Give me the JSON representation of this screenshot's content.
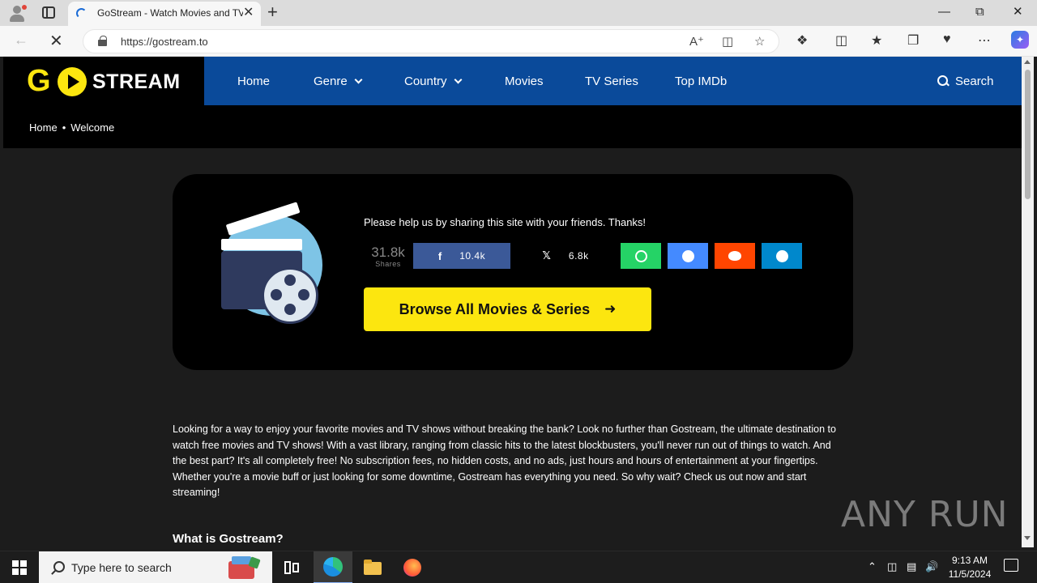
{
  "browser": {
    "tab_title": "GoStream - Watch Movies and TV",
    "url": "https://gostream.to",
    "new_tab_glyph": "+",
    "close_glyph": "✕"
  },
  "site": {
    "logo": {
      "letters": "G",
      "word": "STREAM"
    },
    "nav": [
      {
        "label": "Home"
      },
      {
        "label": "Genre",
        "dropdown": true
      },
      {
        "label": "Country",
        "dropdown": true
      },
      {
        "label": "Movies"
      },
      {
        "label": "TV Series"
      },
      {
        "label": "Top IMDb"
      }
    ],
    "search_label": "Search",
    "breadcrumb": [
      "Home",
      "Welcome"
    ],
    "share": {
      "message": "Please help us by sharing this site with your friends. Thanks!",
      "total_count": "31.8k",
      "total_label": "Shares",
      "buttons": [
        {
          "network": "facebook",
          "icon": "f",
          "count": "10.4k",
          "color": "#3b5998"
        },
        {
          "network": "x",
          "icon": "𝕏",
          "count": "6.8k",
          "color": "#000000"
        },
        {
          "network": "whatsapp",
          "color": "#25d366"
        },
        {
          "network": "messenger",
          "color": "#448aff"
        },
        {
          "network": "reddit",
          "color": "#ff4500"
        },
        {
          "network": "telegram",
          "color": "#0088cc"
        }
      ]
    },
    "browse_button": "Browse All Movies & Series",
    "intro": "Looking for a way to enjoy your favorite movies and TV shows without breaking the bank? Look no further than Gostream, the ultimate destination to watch free movies and TV shows! With a vast library, ranging from classic hits to the latest blockbusters, you'll never run out of things to watch. And the best part? It's all completely free! No subscription fees, no hidden costs, and no ads, just hours and hours of entertainment at your fingertips. Whether you're a movie buff or just looking for some downtime, Gostream has everything you need. So why wait? Check us out now and start streaming!",
    "section_heading": "What is Gostream?",
    "accent_color": "#fce60f",
    "nav_color": "#0a4a9a"
  },
  "watermark": "ANY RUN",
  "taskbar": {
    "search_placeholder": "Type here to search",
    "time": "9:13 AM",
    "date": "11/5/2024"
  }
}
